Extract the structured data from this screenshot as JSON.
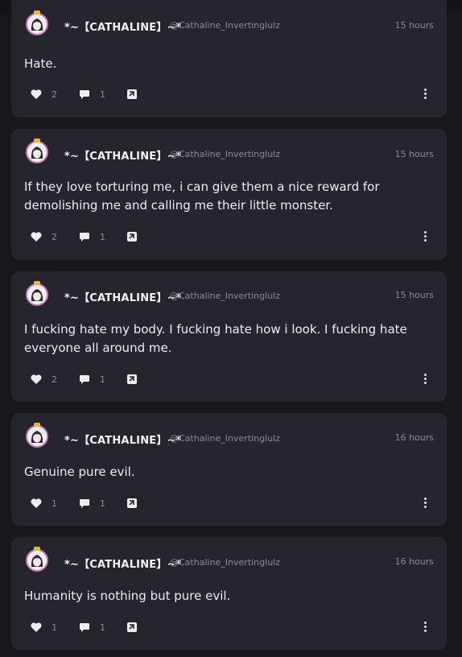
{
  "posts": [
    {
      "display_name": "*~【CATHALINE】~*",
      "handle": "@Cathaline_Invertinglulz",
      "time": "15 hours",
      "text": "Hate.",
      "likes": "2",
      "comments": "1"
    },
    {
      "display_name": "*~【CATHALINE】~*",
      "handle": "@Cathaline_Invertinglulz",
      "time": "15 hours",
      "text": "If they love torturing me, i can give them a nice reward for demolishing me and calling me their little monster.",
      "likes": "2",
      "comments": "1"
    },
    {
      "display_name": "*~【CATHALINE】~*",
      "handle": "@Cathaline_Invertinglulz",
      "time": "15 hours",
      "text": "I fucking hate my body. I fucking hate how i look. I fucking hate everyone all around me.",
      "likes": "2",
      "comments": "1"
    },
    {
      "display_name": "*~【CATHALINE】~*",
      "handle": "@Cathaline_Invertinglulz",
      "time": "16 hours",
      "text": "Genuine pure evil.",
      "likes": "1",
      "comments": "1"
    },
    {
      "display_name": "*~【CATHALINE】~*",
      "handle": "@Cathaline_Invertinglulz",
      "time": "16 hours",
      "text": "Humanity is nothing but pure evil.",
      "likes": "1",
      "comments": "1"
    }
  ],
  "icons": {
    "like": "heart-icon",
    "comment": "speech-bubble-icon",
    "share": "share-icon",
    "more": "vertical-ellipsis-icon"
  },
  "colors": {
    "background": "#18171d",
    "card": "#26252d",
    "avatar_ring": "#c874b4",
    "muted_text": "#8b8a95"
  }
}
